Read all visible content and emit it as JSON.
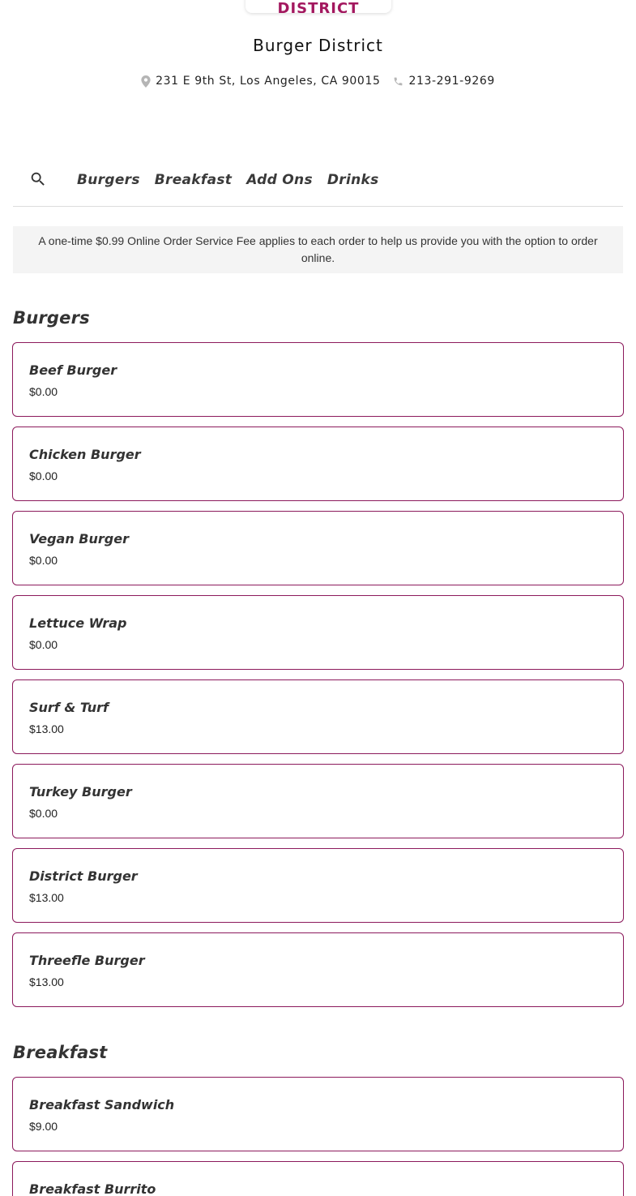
{
  "header": {
    "logo_text": "ORDER DISTRICT",
    "restaurant_name": "Burger District",
    "address": "231 E 9th St, Los Angeles, CA 90015",
    "phone": "213-291-9269"
  },
  "nav": {
    "tabs": [
      "Burgers",
      "Breakfast",
      "Add Ons",
      "Drinks"
    ]
  },
  "notice": "A one-time $0.99 Online Order Service Fee applies to each order to help us provide you with the option to order online.",
  "colors": {
    "accent": "#8c1a5c",
    "logo": "#a3185f",
    "notice_bg": "#f4f4f4"
  },
  "sections": [
    {
      "title": "Burgers",
      "items": [
        {
          "name": "Beef Burger",
          "price": "$0.00"
        },
        {
          "name": "Chicken Burger",
          "price": "$0.00"
        },
        {
          "name": "Vegan Burger",
          "price": "$0.00"
        },
        {
          "name": "Lettuce Wrap",
          "price": "$0.00"
        },
        {
          "name": "Surf & Turf",
          "price": "$13.00"
        },
        {
          "name": "Turkey Burger",
          "price": "$0.00"
        },
        {
          "name": "District Burger",
          "price": "$13.00"
        },
        {
          "name": "Threefle Burger",
          "price": "$13.00"
        }
      ]
    },
    {
      "title": "Breakfast",
      "items": [
        {
          "name": "Breakfast Sandwich",
          "price": "$9.00"
        },
        {
          "name": "Breakfast Burrito",
          "price": ""
        }
      ]
    }
  ]
}
